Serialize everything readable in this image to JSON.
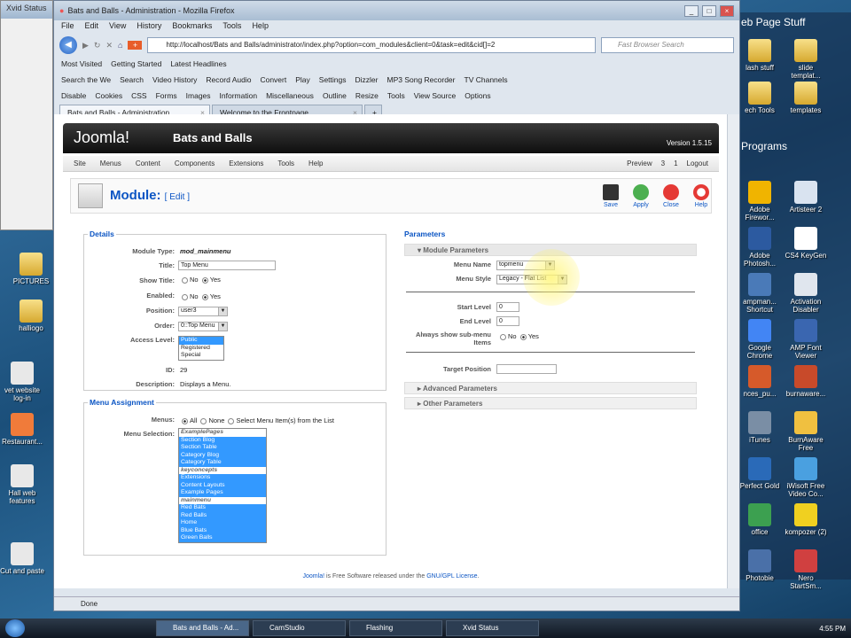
{
  "desktop": {
    "xvid_title": "Xvid Status",
    "left_icons": [
      "PICTURES",
      "halliogo",
      "vet website log-in",
      "Restaurant...",
      "Hall web features",
      "Cut and paste"
    ],
    "right_window": {
      "title": "eb Page Stuff",
      "programs_title": "Programs",
      "icons": [
        "lash stuff",
        "slide templat...",
        "ech Tools",
        "templates",
        "Adobe Firewor...",
        "Artisteer 2",
        "Adobe Photosh...",
        "CS4 KeyGen",
        "ampman... Shortcut",
        "Activation Disabler",
        "Google Chrome",
        "AMP Font Viewer",
        "nces_pu...",
        "burnaware...",
        "iTunes",
        "BurnAware Free",
        "Perfect Gold",
        "iWisoft Free Video Co...",
        "office",
        "kompozer (2)",
        "Photobie",
        "Nero StartSm..."
      ]
    }
  },
  "browser": {
    "title": "Bats and Balls - Administration - Mozilla Firefox",
    "menu": [
      "File",
      "Edit",
      "View",
      "History",
      "Bookmarks",
      "Tools",
      "Help"
    ],
    "url": "http://localhost/Bats and Balls/administrator/index.php?option=com_modules&client=0&task=edit&cid[]=2",
    "search_placeholder": "Fast Browser Search",
    "bookmarks": [
      "Most Visited",
      "Getting Started",
      "Latest Headlines"
    ],
    "toolbar2": [
      "Search the We",
      "Search",
      "Video History",
      "Record Audio",
      "Convert",
      "Play",
      "Settings",
      "Dizzler",
      "MP3 Song Recorder",
      "TV Channels"
    ],
    "toolbar3": [
      "Disable",
      "Cookies",
      "CSS",
      "Forms",
      "Images",
      "Information",
      "Miscellaneous",
      "Outline",
      "Resize",
      "Tools",
      "View Source",
      "Options"
    ],
    "tabs": [
      "Bats and Balls - Administration",
      "Welcome to the Frontpage"
    ],
    "status": "Done"
  },
  "joomla": {
    "logo": "Joomla!",
    "site": "Bats and Balls",
    "version": "Version 1.5.15",
    "menu": [
      "Site",
      "Menus",
      "Content",
      "Components",
      "Extensions",
      "Tools",
      "Help"
    ],
    "right": {
      "preview": "Preview",
      "messages": "3",
      "users": "1",
      "logout": "Logout"
    },
    "page_title": "Module:",
    "page_sub": "[ Edit ]",
    "tools": [
      "Save",
      "Apply",
      "Close",
      "Help"
    ],
    "details": {
      "legend": "Details",
      "module_type_label": "Module Type:",
      "module_type": "mod_mainmenu",
      "title_label": "Title:",
      "title": "Top Menu",
      "show_title_label": "Show Title:",
      "enabled_label": "Enabled:",
      "no": "No",
      "yes": "Yes",
      "position_label": "Position:",
      "position": "user3",
      "order_label": "Order:",
      "order": "0::Top Menu",
      "access_label": "Access Level:",
      "access": [
        "Public",
        "Registered",
        "Special"
      ],
      "id_label": "ID:",
      "id": "29",
      "desc_label": "Description:",
      "desc": "Displays a Menu."
    },
    "assign": {
      "legend": "Menu Assignment",
      "menus_label": "Menus:",
      "all": "All",
      "none": "None",
      "select": "Select Menu Item(s) from the List",
      "selection_label": "Menu Selection:",
      "items": [
        {
          "t": "ExamplePages",
          "og": true
        },
        {
          "t": "Section Blog"
        },
        {
          "t": "Section Table"
        },
        {
          "t": "Category Blog"
        },
        {
          "t": "Category Table"
        },
        {
          "t": "keyconcepts",
          "og": true
        },
        {
          "t": "Extensions"
        },
        {
          "t": "Content Layouts"
        },
        {
          "t": "Example Pages"
        },
        {
          "t": "mainmenu",
          "og": true
        },
        {
          "t": "Red Bats"
        },
        {
          "t": "Red Balls"
        },
        {
          "t": "Home"
        },
        {
          "t": "Blue Bats"
        },
        {
          "t": "Green Balls"
        }
      ]
    },
    "params": {
      "legend": "Parameters",
      "module_params": "Module Parameters",
      "menu_name_label": "Menu Name",
      "menu_name": "topmenu",
      "menu_style_label": "Menu Style",
      "menu_style": "Legacy - Flat List",
      "start_label": "Start Level",
      "start": "0",
      "end_label": "End Level",
      "end": "0",
      "always_label": "Always show sub-menu Items",
      "no": "No",
      "yes": "Yes",
      "target_label": "Target Position",
      "advanced": "Advanced Parameters",
      "other": "Other Parameters"
    },
    "footer_link": "Joomla!",
    "footer_mid": " is Free Software released under the ",
    "footer_link2": "GNU/GPL License",
    "footer_end": "."
  },
  "taskbar": {
    "items": [
      "Bats and Balls - Ad...",
      "CamStudio",
      "Flashing",
      "Xvid Status"
    ],
    "clock": "4:55 PM"
  }
}
